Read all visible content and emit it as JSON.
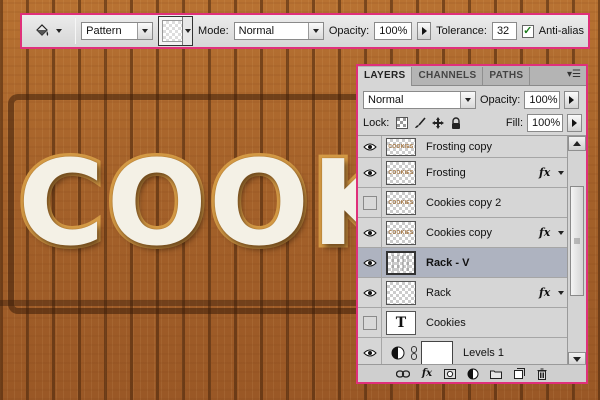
{
  "canvas": {
    "text": "COOKIES"
  },
  "options_bar": {
    "fill_source": "Pattern",
    "mode_label": "Mode:",
    "mode_value": "Normal",
    "opacity_label": "Opacity:",
    "opacity_value": "100%",
    "tolerance_label": "Tolerance:",
    "tolerance_value": "32",
    "antialias_label": "Anti-alias",
    "antialias_checked": true
  },
  "layers_panel": {
    "tabs": [
      "LAYERS",
      "CHANNELS",
      "PATHS"
    ],
    "active_tab": "LAYERS",
    "blend_mode": "Normal",
    "opacity_label": "Opacity:",
    "opacity_value": "100%",
    "lock_label": "Lock:",
    "fill_label": "Fill:",
    "fill_value": "100%",
    "layers": [
      {
        "name": "Frosting copy",
        "visible": true,
        "fx": false,
        "thumb": "frosting"
      },
      {
        "name": "Frosting",
        "visible": true,
        "fx": true,
        "thumb": "frosting"
      },
      {
        "name": "Cookies copy 2",
        "visible": false,
        "fx": false,
        "thumb": "cookies"
      },
      {
        "name": "Cookies copy",
        "visible": true,
        "fx": true,
        "thumb": "cookies"
      },
      {
        "name": "Rack - V",
        "visible": true,
        "fx": false,
        "thumb": "rack",
        "selected": true
      },
      {
        "name": "Rack",
        "visible": true,
        "fx": true,
        "thumb": "rack"
      },
      {
        "name": "Cookies",
        "visible": false,
        "fx": false,
        "thumb": "text",
        "thumb_glyph": "T"
      },
      {
        "name": "Levels 1",
        "visible": true,
        "fx": false,
        "thumb": "adjustment"
      }
    ],
    "fx_glyph": "fx",
    "thumb_text_frosting": "COOKIES",
    "thumb_text_cookies": "COOKIES"
  },
  "colors": {
    "highlight_border": "#e0307a",
    "selected_row": "#aeb3c0"
  }
}
